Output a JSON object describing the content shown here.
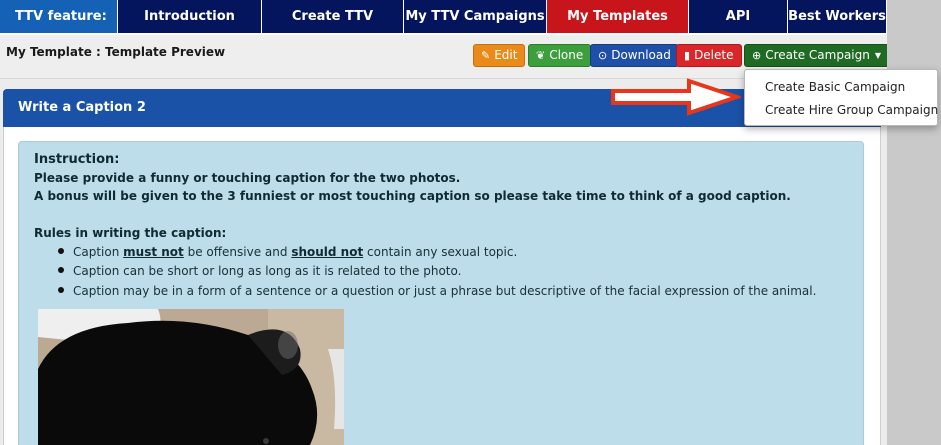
{
  "nav": {
    "feature": "TTV feature:",
    "items": [
      {
        "label": "Introduction"
      },
      {
        "label": "Create TTV Campaign"
      },
      {
        "label": "My TTV Campaigns"
      },
      {
        "label": "My Templates"
      },
      {
        "label": "API"
      },
      {
        "label": "Best Workers"
      }
    ],
    "active": "My Templates"
  },
  "header": {
    "title": "My Template : Template Preview",
    "buttons": {
      "edit": "Edit",
      "clone": "Clone",
      "download": "Download",
      "delete": "Delete",
      "create_campaign": "Create Campaign"
    }
  },
  "dropdown": {
    "items": [
      "Create Basic Campaign",
      "Create Hire Group Campaign"
    ]
  },
  "panel": {
    "title": "Write a Caption 2",
    "instruction_title": "Instruction:",
    "instruction_lines": [
      "Please provide a funny or touching caption for the two photos.",
      "A bonus will be given to the 3 funniest or most touching caption so please take time to think of a good caption."
    ],
    "rules_title": "Rules in writing the caption:",
    "rules": [
      {
        "pre": "Caption ",
        "em1": "must not",
        "mid": " be offensive and ",
        "em2": "should not",
        "post": " contain any sexual topic."
      },
      {
        "text": "Caption can be short or long as long as it is related to the photo."
      },
      {
        "text": "Caption may be in a form of a sentence or a question or just a phrase but descriptive of the facial expression of the animal."
      }
    ]
  },
  "colors": {
    "nav_bg": "#04155e",
    "nav_feature": "#1561b6",
    "nav_active": "#c8141b",
    "panel_head": "#1a52a8",
    "info_box": "#bcdde9",
    "annotation_arrow": "#e8361c"
  },
  "icons": {
    "edit": "pencil-icon",
    "clone": "leaf-icon",
    "download": "download-circle-icon",
    "delete": "trash-icon",
    "create_campaign": "plus-circle-icon"
  }
}
